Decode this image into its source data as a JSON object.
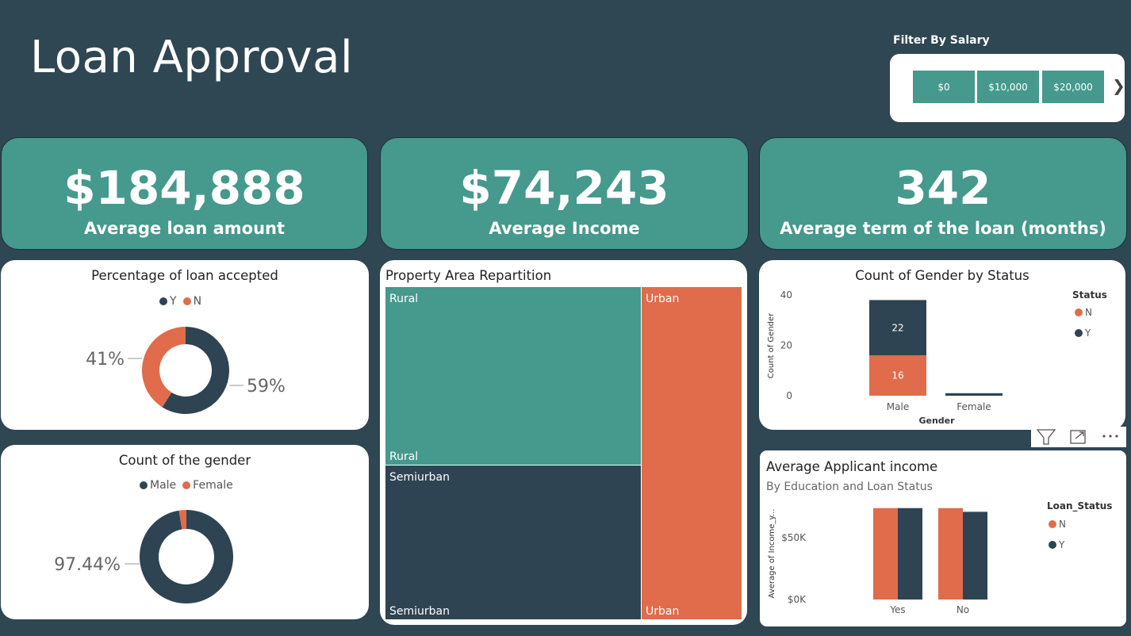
{
  "header": {
    "title": "Loan Approval",
    "filter_label": "Filter By Salary",
    "filter_options": [
      "$0",
      "$10,000",
      "$20,000"
    ]
  },
  "kpis": [
    {
      "value": "$184,888",
      "label": "Average loan amount"
    },
    {
      "value": "$74,243",
      "label": "Average Income"
    },
    {
      "value": "342",
      "label": "Average term of the loan (months)"
    }
  ],
  "colors": {
    "background": "#2f4653",
    "teal": "#45998d",
    "dark": "#2e4452",
    "orange": "#e06c4b",
    "card": "#ffffff"
  },
  "chart_data": [
    {
      "type": "pie",
      "title": "Percentage of loan accepted",
      "labels": [
        "Y",
        "N"
      ],
      "values": [
        59,
        41
      ],
      "data_labels": [
        "59%",
        "41%"
      ],
      "colors": [
        "#2e4452",
        "#e06c4b"
      ],
      "legend": "top"
    },
    {
      "type": "pie",
      "title": "Count of the gender",
      "labels": [
        "Male",
        "Female"
      ],
      "values": [
        97.44,
        2.56
      ],
      "data_labels": [
        "97.44%"
      ],
      "colors": [
        "#2e4452",
        "#e06c4b"
      ],
      "legend": "top"
    },
    {
      "type": "heatmap",
      "title": "Property Area Repartition",
      "labels": [
        "Rural",
        "Semiurban",
        "Urban"
      ],
      "colors": [
        "#45998d",
        "#2e4452",
        "#e06c4b"
      ]
    },
    {
      "type": "bar",
      "title": "Count of Gender by Status",
      "categories": [
        "Male",
        "Female"
      ],
      "series": [
        {
          "name": "N",
          "values": [
            16,
            0
          ]
        },
        {
          "name": "Y",
          "values": [
            22,
            1
          ]
        }
      ],
      "data_labels": [
        "16",
        "22"
      ],
      "xlabel": "Gender",
      "ylabel": "Count of Gender",
      "ylim": [
        0,
        40
      ],
      "yticks": [
        "0",
        "20",
        "40"
      ],
      "legend_title": "Status",
      "legend": "right"
    },
    {
      "type": "bar",
      "title": "Average Applicant income",
      "subtitle": "By Education and Loan Status",
      "categories": [
        "Yes",
        "No"
      ],
      "series": [
        {
          "name": "N",
          "values": [
            74000,
            74000
          ]
        },
        {
          "name": "Y",
          "values": [
            74000,
            71000
          ]
        }
      ],
      "xlabel": "",
      "ylabel": "Average of Income_y...",
      "ylim": [
        0,
        95000
      ],
      "yticks": [
        "$0K",
        "$50K"
      ],
      "legend_title": "Loan_Status",
      "legend": "right"
    }
  ]
}
